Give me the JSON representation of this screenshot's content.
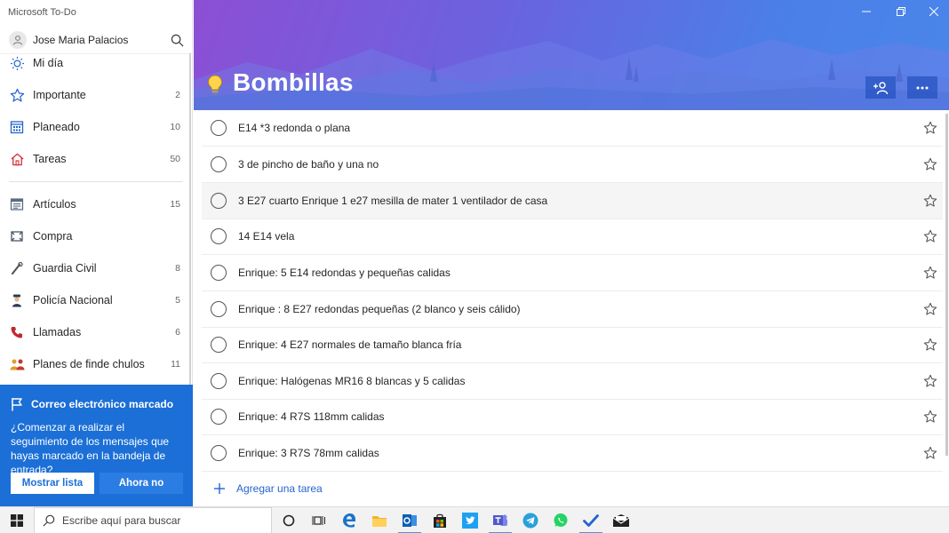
{
  "app": {
    "title": "Microsoft To-Do"
  },
  "user": {
    "name": "Jose Maria Palacios"
  },
  "sidebar": {
    "items": [
      {
        "label": "Mi día",
        "count": ""
      },
      {
        "label": "Importante",
        "count": "2"
      },
      {
        "label": "Planeado",
        "count": "10"
      },
      {
        "label": "Tareas",
        "count": "50"
      },
      {
        "label": "Artículos",
        "count": "15"
      },
      {
        "label": "Compra",
        "count": ""
      },
      {
        "label": "Guardia Civil",
        "count": "8"
      },
      {
        "label": "Policía Nacional",
        "count": "5"
      },
      {
        "label": "Llamadas",
        "count": "6"
      },
      {
        "label": "Planes de finde chulos",
        "count": "11"
      }
    ]
  },
  "promo": {
    "title": "Correo electrónico marcado",
    "text": "¿Comenzar a realizar el seguimiento de los mensajes que hayas marcado en la bandeja de entrada?",
    "primary_button": "Mostrar lista",
    "secondary_button": "Ahora no"
  },
  "list": {
    "title": "Bombillas",
    "tasks": [
      "E14 *3 redonda o plana",
      "3 de pincho de baño y una no",
      "3 E27 cuarto Enrique 1 e27 mesilla de mater 1 ventilador de casa",
      "14 E14 vela",
      "Enrique: 5 E14 redondas y pequeñas calidas",
      "Enrique : 8 E27 redondas pequeñas (2 blanco y seis cálido)",
      "Enrique: 4 E27 normales de tamaño blanca fría",
      "Enrique: Halógenas MR16 8 blancas y 5 calidas",
      "Enrique: 4 R7S 118mm calidas",
      "Enrique: 3 R7S 78mm calidas"
    ],
    "add_task_label": "Agregar una tarea"
  },
  "taskbar": {
    "search_placeholder": "Escribe aquí para buscar"
  },
  "colors": {
    "accent": "#1b6fd6",
    "banner_start": "#8c4fd4",
    "banner_end": "#4a86ea"
  }
}
